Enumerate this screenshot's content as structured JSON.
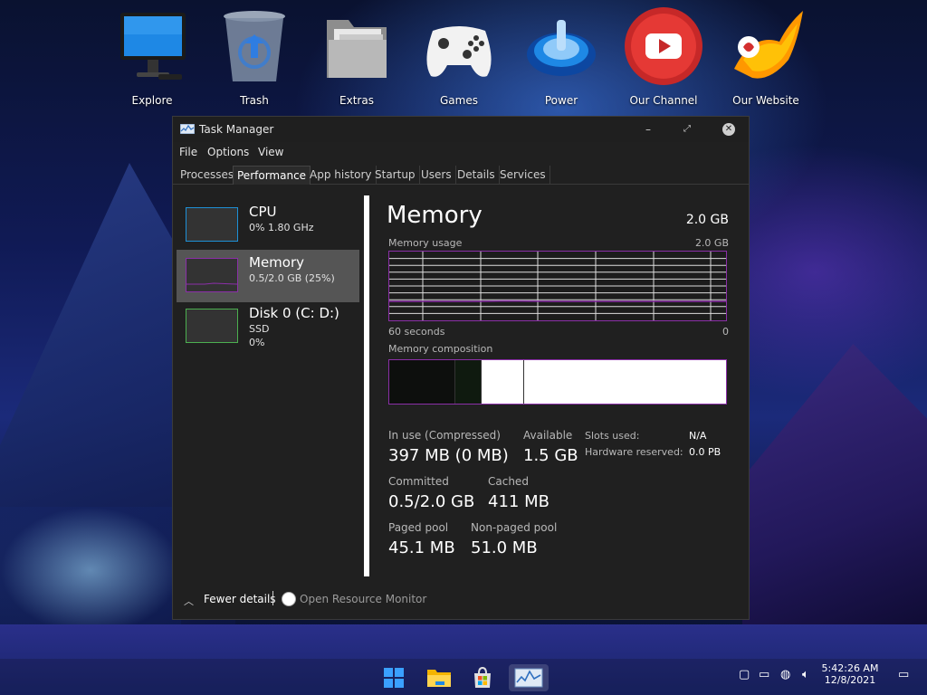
{
  "desktop": {
    "icons": [
      {
        "label": "Explore",
        "icon": "monitor-icon"
      },
      {
        "label": "Trash",
        "icon": "recycle-bin-icon"
      },
      {
        "label": "Extras",
        "icon": "folder-icon"
      },
      {
        "label": "Games",
        "icon": "gamepad-icon"
      },
      {
        "label": "Power",
        "icon": "power-icon"
      },
      {
        "label": "Our Channel",
        "icon": "youtube-icon"
      },
      {
        "label": "Our Website",
        "icon": "phoenix-logo-icon"
      }
    ]
  },
  "window": {
    "title": "Task Manager",
    "controls": {
      "minimize": "–",
      "maximize": "⤢",
      "close": "✕"
    },
    "menu": [
      "File",
      "Options",
      "View"
    ],
    "tabs": [
      "Processes",
      "Performance",
      "App history",
      "Startup",
      "Users",
      "Details",
      "Services"
    ],
    "active_tab": "Performance"
  },
  "sidebar": {
    "items": [
      {
        "title": "CPU",
        "line1": "0%  1.80 GHz",
        "line2": "",
        "accent": "#1e90d6"
      },
      {
        "title": "Memory",
        "line1": "0.5/2.0 GB (25%)",
        "line2": "",
        "accent": "#8b2fa8"
      },
      {
        "title": "Disk 0 (C: D:)",
        "line1": "SSD",
        "line2": "0%",
        "accent": "#4caf50"
      }
    ],
    "selected": "Memory"
  },
  "memory": {
    "title": "Memory",
    "total": "2.0 GB",
    "usage_label": "Memory usage",
    "usage_max": "2.0 GB",
    "time_left": "60 seconds",
    "time_right": "0",
    "composition_label": "Memory composition",
    "composition_segments": [
      {
        "part": "in-use",
        "fraction": 0.195,
        "color": "#0d0f0d"
      },
      {
        "part": "modified",
        "fraction": 0.075,
        "color": "#0f1a0f"
      },
      {
        "part": "standby",
        "fraction": 0.125,
        "color": "#ffffff"
      },
      {
        "part": "free",
        "fraction": 0.605,
        "color": "#ffffff"
      }
    ],
    "stats": {
      "in_use_label": "In use (Compressed)",
      "in_use_value": "397 MB (0 MB)",
      "available_label": "Available",
      "available_value": "1.5 GB",
      "committed_label": "Committed",
      "committed_value": "0.5/2.0 GB",
      "cached_label": "Cached",
      "cached_value": "411 MB",
      "paged_label": "Paged pool",
      "paged_value": "45.1 MB",
      "nonpaged_label": "Non-paged pool",
      "nonpaged_value": "51.0 MB"
    },
    "meta": {
      "slots_label": "Slots used:",
      "slots_value": "N/A",
      "hw_label": "Hardware reserved:",
      "hw_value": "0.0 PB"
    },
    "graph_line_color": "#8b2fa8"
  },
  "footer": {
    "fewer_details": "Fewer details",
    "open_resource_monitor": "Open Resource Monitor"
  },
  "taskbar": {
    "apps": [
      "windows-start-icon",
      "file-explorer-icon",
      "store-icon",
      "task-manager-icon"
    ],
    "clock_time": "5:42:26 AM",
    "clock_date": "12/8/2021"
  }
}
